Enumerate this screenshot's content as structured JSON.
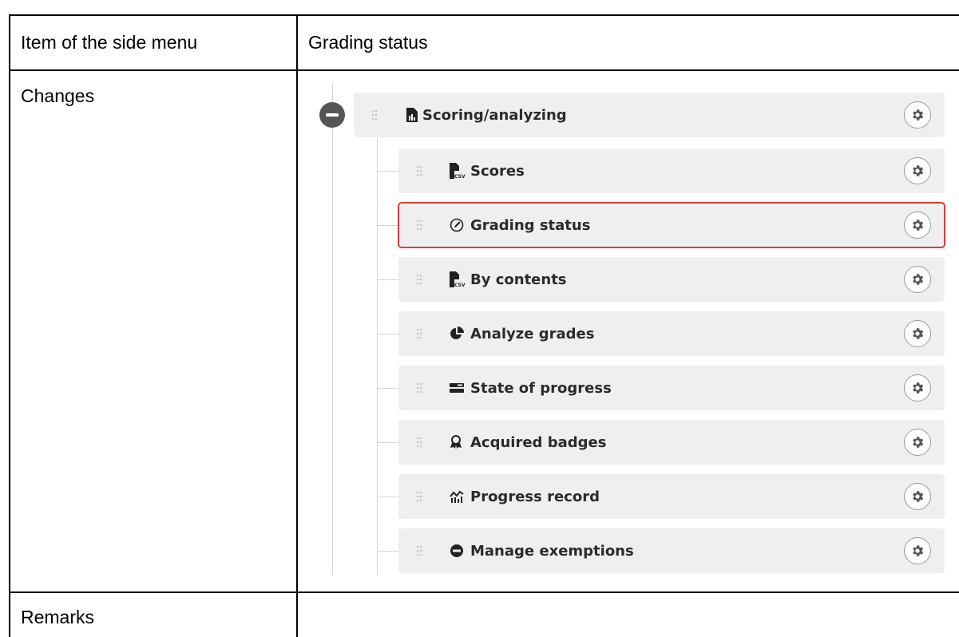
{
  "table": {
    "header_label": "Item of the side menu",
    "header_value": "Grading status",
    "changes_label": "Changes",
    "remarks_label": "Remarks"
  },
  "menu": {
    "parent": {
      "label": "Scoring/analyzing",
      "icon": "file-chart-icon"
    },
    "items": [
      {
        "label": "Scores",
        "icon": "file-csv-icon"
      },
      {
        "label": "Grading status",
        "icon": "pen-circle-icon",
        "highlighted": true
      },
      {
        "label": "By contents",
        "icon": "file-csv-icon"
      },
      {
        "label": "Analyze grades",
        "icon": "pie-chart-icon"
      },
      {
        "label": "State of progress",
        "icon": "bars-icon"
      },
      {
        "label": "Acquired badges",
        "icon": "award-icon"
      },
      {
        "label": "Progress record",
        "icon": "line-chart-icon"
      },
      {
        "label": "Manage exemptions",
        "icon": "minus-circle-icon"
      }
    ]
  },
  "colors": {
    "highlight": "#e0393e",
    "row_bg": "#efefef",
    "text": "#2b2b2b"
  }
}
